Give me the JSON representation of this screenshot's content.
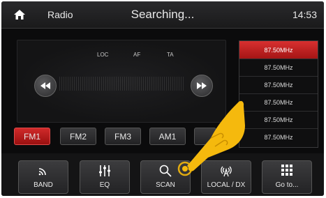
{
  "header": {
    "title": "Radio",
    "status": "Searching...",
    "time": "14:53"
  },
  "panel": {
    "flags": [
      "LOC",
      "AF",
      "TA"
    ]
  },
  "bands": [
    "FM1",
    "FM2",
    "FM3",
    "AM1",
    ""
  ],
  "frequencies": [
    "87.50MHz",
    "87.50MHz",
    "87.50MHz",
    "87.50MHz",
    "87.50MHz",
    "87.50MHz"
  ],
  "bottom_bar": [
    {
      "label": "BAND",
      "icon": "band-signal-icon"
    },
    {
      "label": "EQ",
      "icon": "equalizer-icon"
    },
    {
      "label": "SCAN",
      "icon": "search-icon"
    },
    {
      "label": "LOCAL / DX",
      "icon": "antenna-icon"
    },
    {
      "label": "Go to...",
      "icon": "keypad-icon"
    }
  ],
  "colors": {
    "accent": "#c81e1e",
    "hand": "#f5b90d"
  }
}
